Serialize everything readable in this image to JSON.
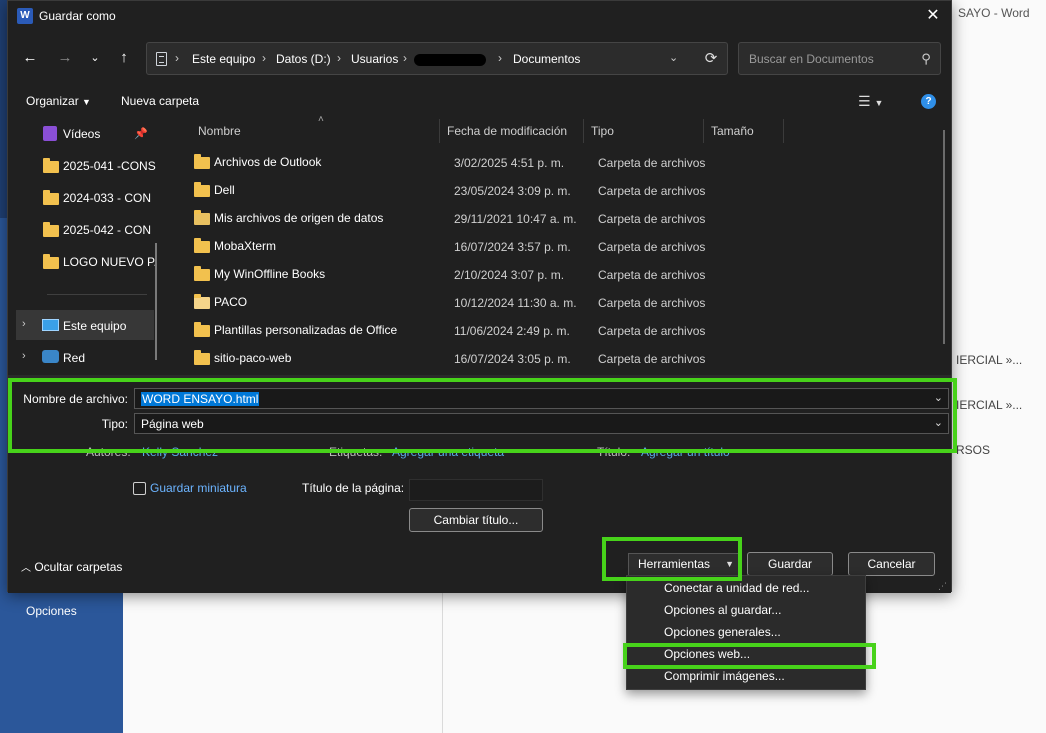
{
  "background": {
    "window_title_fragment": "SAYO - Word",
    "side_items": [
      "IERCIAL »...",
      "IERCIAL »...",
      "RSOS"
    ],
    "opciones_label": "Opciones"
  },
  "dialog": {
    "title": "Guardar como",
    "app_icon_letter": "W",
    "address_crumbs": [
      "Este equipo",
      "Datos (D:)",
      "Usuarios",
      "Documentos"
    ],
    "search_placeholder": "Buscar en Documentos",
    "toolbar": {
      "organize": "Organizar",
      "new_folder": "Nueva carpeta"
    },
    "nav_items": [
      {
        "label": "Vídeos",
        "type": "video"
      },
      {
        "label": "2025-041 -CONS",
        "type": "folder"
      },
      {
        "label": "2024-033 - CON",
        "type": "folder"
      },
      {
        "label": "2025-042 - CON",
        "type": "folder"
      },
      {
        "label": "LOGO NUEVO P.",
        "type": "folder"
      },
      {
        "label": "Este equipo",
        "type": "pc"
      },
      {
        "label": "Red",
        "type": "network"
      }
    ],
    "columns": [
      "Nombre",
      "Fecha de modificación",
      "Tipo",
      "Tamaño"
    ],
    "files": [
      {
        "name": "Archivos de Outlook",
        "date": "3/02/2025 4:51 p. m.",
        "type": "Carpeta de archivos"
      },
      {
        "name": "Dell",
        "date": "23/05/2024 3:09 p. m.",
        "type": "Carpeta de archivos"
      },
      {
        "name": "Mis archivos de origen de datos",
        "date": "29/11/2021 10:47 a. m.",
        "type": "Carpeta de archivos"
      },
      {
        "name": "MobaXterm",
        "date": "16/07/2024 3:57 p. m.",
        "type": "Carpeta de archivos"
      },
      {
        "name": "My WinOffline Books",
        "date": "2/10/2024 3:07 p. m.",
        "type": "Carpeta de archivos"
      },
      {
        "name": "PACO",
        "date": "10/12/2024 11:30 a. m.",
        "type": "Carpeta de archivos"
      },
      {
        "name": "Plantillas personalizadas de Office",
        "date": "11/06/2024 2:49 p. m.",
        "type": "Carpeta de archivos"
      },
      {
        "name": "sitio-paco-web",
        "date": "16/07/2024 3:05 p. m.",
        "type": "Carpeta de archivos"
      }
    ],
    "form": {
      "filename_label": "Nombre de archivo:",
      "filename_value": "WORD ENSAYO.html",
      "type_label": "Tipo:",
      "type_value": "Página web",
      "authors_label": "Autores:",
      "authors_value": "Kelly Sanchez",
      "tags_label": "Etiquetas:",
      "tags_value": "Agregar una etiqueta",
      "title_label": "Título:",
      "title_value": "Agregar un título",
      "thumbnail_label": "Guardar miniatura",
      "page_title_label": "Título de la página:",
      "change_title_button": "Cambiar título..."
    },
    "hide_folders": "Ocultar carpetas",
    "tools_button": "Herramientas",
    "save_button": "Guardar",
    "cancel_button": "Cancelar"
  },
  "tools_menu": [
    "Conectar a unidad de red...",
    "Opciones al guardar...",
    "Opciones generales...",
    "Opciones web...",
    "Comprimir imágenes..."
  ],
  "highlight_color": "#47d21a",
  "accent_color": "#0078d7"
}
